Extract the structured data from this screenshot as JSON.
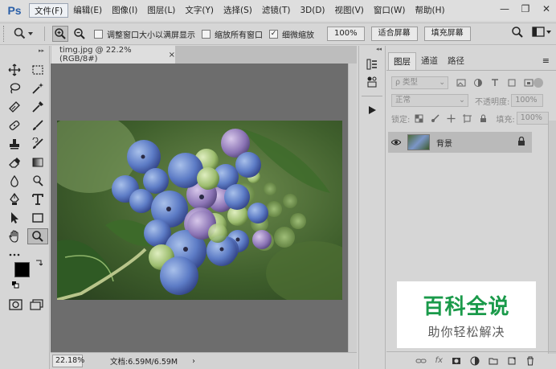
{
  "app": {
    "logo": "Ps"
  },
  "menu": [
    {
      "label": "文件(F)",
      "active": true
    },
    {
      "label": "编辑(E)"
    },
    {
      "label": "图像(I)"
    },
    {
      "label": "图层(L)"
    },
    {
      "label": "文字(Y)"
    },
    {
      "label": "选择(S)"
    },
    {
      "label": "滤镜(T)"
    },
    {
      "label": "3D(D)"
    },
    {
      "label": "视图(V)"
    },
    {
      "label": "窗口(W)"
    },
    {
      "label": "帮助(H)"
    }
  ],
  "window_controls": {
    "minimize": "—",
    "restore": "❐",
    "close": "✕"
  },
  "options": {
    "resize_windows": {
      "label": "调整窗口大小以满屏显示",
      "checked": false
    },
    "zoom_all": {
      "label": "缩放所有窗口",
      "checked": false
    },
    "scrubby_zoom": {
      "label": "细微缩放",
      "checked": true
    },
    "zoom_100": "100%",
    "fit_screen": "适合屏幕",
    "fill_screen": "填充屏幕"
  },
  "document": {
    "tab_title": "timg.jpg @ 22.2%(RGB/8#)",
    "close": "×",
    "zoom": "22.18%",
    "info": "文档:6.59M/6.59M",
    "status_arrow": "›"
  },
  "layers_panel": {
    "tabs": [
      "图层",
      "通道",
      "路径"
    ],
    "active_tab": 0,
    "menu_icon": "≡",
    "filter_kind": "ρ 类型",
    "blend_mode": "正常",
    "opacity_label": "不透明度:",
    "opacity_value": "100%",
    "lock_label": "锁定:",
    "fill_label": "填充:",
    "fill_value": "100%",
    "layers": [
      {
        "name": "背景",
        "visible": true,
        "locked": true
      }
    ],
    "bottom_icons": [
      "link-icon",
      "fx-icon",
      "mask-icon",
      "adjustment-icon",
      "group-icon",
      "new-layer-icon",
      "trash-icon"
    ],
    "bottom_fx": "fx"
  },
  "watermark": {
    "title": "百科全说",
    "subtitle": "助你轻松解决",
    "title_color": "#1a9a4a"
  }
}
